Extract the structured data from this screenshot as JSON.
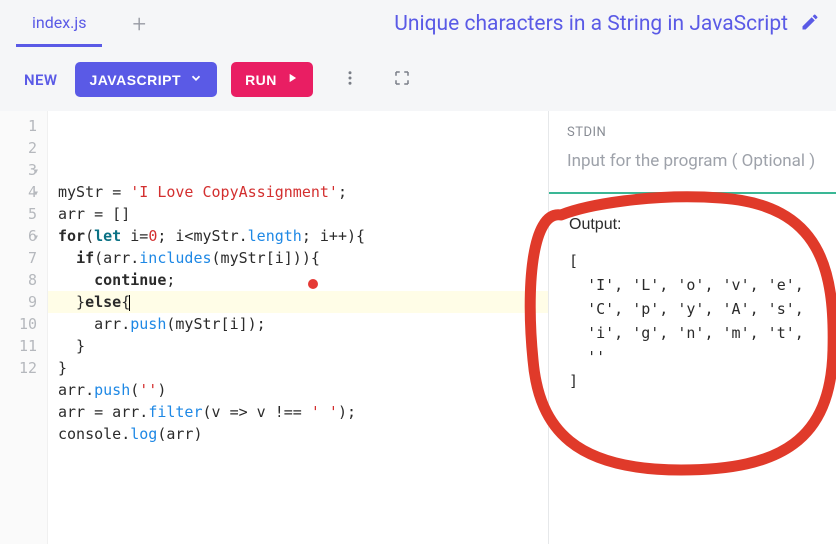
{
  "header": {
    "tab_name": "index.js",
    "title": "Unique characters in a String in JavaScript"
  },
  "toolbar": {
    "new_label": "NEW",
    "lang_label": "JAVASCRIPT",
    "run_label": "RUN"
  },
  "editor": {
    "lines": [
      {
        "n": 1,
        "fold": false,
        "tokens": [
          [
            "ident",
            "myStr "
          ],
          [
            "op",
            "= "
          ],
          [
            "str",
            "'I Love CopyAssignment'"
          ],
          [
            "op",
            ";"
          ]
        ]
      },
      {
        "n": 2,
        "fold": false,
        "tokens": [
          [
            "ident",
            "arr "
          ],
          [
            "op",
            "= []"
          ]
        ]
      },
      {
        "n": 3,
        "fold": true,
        "tokens": [
          [
            "kw2",
            "for"
          ],
          [
            "op",
            "("
          ],
          [
            "kw",
            "let "
          ],
          [
            "ident",
            "i"
          ],
          [
            "op",
            "="
          ],
          [
            "num",
            "0"
          ],
          [
            "op",
            "; i<myStr."
          ],
          [
            "prop",
            "length"
          ],
          [
            "op",
            "; i++){"
          ]
        ]
      },
      {
        "n": 4,
        "fold": true,
        "tokens": [
          [
            "op",
            "  "
          ],
          [
            "kw2",
            "if"
          ],
          [
            "op",
            "(arr."
          ],
          [
            "fn",
            "includes"
          ],
          [
            "op",
            "(myStr[i])){"
          ]
        ]
      },
      {
        "n": 5,
        "fold": false,
        "tokens": [
          [
            "op",
            "    "
          ],
          [
            "kw2",
            "continue"
          ],
          [
            "op",
            ";"
          ]
        ]
      },
      {
        "n": 6,
        "fold": true,
        "hl": true,
        "tokens": [
          [
            "op",
            "  }"
          ],
          [
            "kw2",
            "else"
          ],
          [
            "op",
            "{"
          ],
          [
            "caret",
            ""
          ]
        ]
      },
      {
        "n": 7,
        "fold": false,
        "tokens": [
          [
            "op",
            "    arr."
          ],
          [
            "fn",
            "push"
          ],
          [
            "op",
            "(myStr[i]);"
          ]
        ]
      },
      {
        "n": 8,
        "fold": false,
        "tokens": [
          [
            "op",
            "  }"
          ]
        ]
      },
      {
        "n": 9,
        "fold": false,
        "tokens": [
          [
            "op",
            "}"
          ]
        ]
      },
      {
        "n": 10,
        "fold": false,
        "tokens": [
          [
            "ident",
            "arr"
          ],
          [
            "op",
            "."
          ],
          [
            "fn",
            "push"
          ],
          [
            "op",
            "("
          ],
          [
            "str",
            "''"
          ],
          [
            "op",
            ")"
          ]
        ]
      },
      {
        "n": 11,
        "fold": false,
        "tokens": [
          [
            "ident",
            "arr "
          ],
          [
            "op",
            "= arr."
          ],
          [
            "fn",
            "filter"
          ],
          [
            "op",
            "(v => v !== "
          ],
          [
            "str",
            "' '"
          ],
          [
            "op",
            ");"
          ]
        ]
      },
      {
        "n": 12,
        "fold": false,
        "tokens": [
          [
            "ident",
            "console"
          ],
          [
            "op",
            "."
          ],
          [
            "fn",
            "log"
          ],
          [
            "op",
            "(arr)"
          ]
        ]
      }
    ]
  },
  "stdin": {
    "label": "STDIN",
    "placeholder": "Input for the program ( Optional )"
  },
  "output": {
    "label": "Output:",
    "text": "[\n  'I', 'L', 'o', 'v', 'e',\n  'C', 'p', 'y', 'A', 's',\n  'i', 'g', 'n', 'm', 't',\n  ''\n]"
  },
  "colors": {
    "accent": "#5a5ae6",
    "run": "#e91e63"
  }
}
